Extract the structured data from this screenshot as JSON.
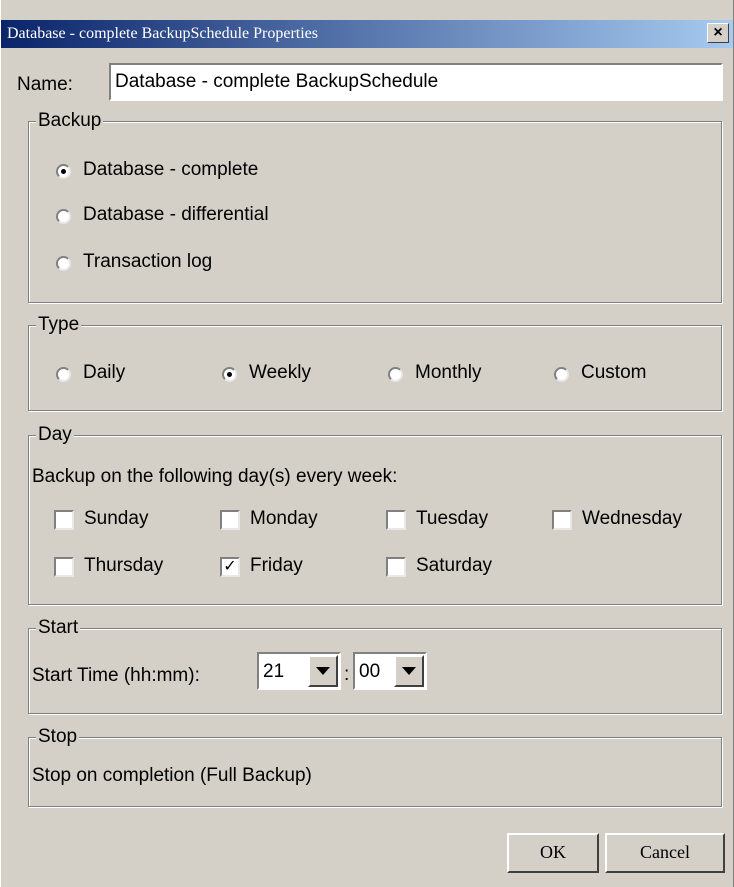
{
  "window": {
    "title": "Database - complete BackupSchedule Properties",
    "close_glyph": "×"
  },
  "name": {
    "label": "Name:",
    "value": "Database - complete BackupSchedule"
  },
  "backup": {
    "legend": "Backup",
    "options": [
      "Database - complete",
      "Database - differential",
      "Transaction log"
    ],
    "selected": "Database - complete"
  },
  "type": {
    "legend": "Type",
    "options": [
      "Daily",
      "Weekly",
      "Monthly",
      "Custom"
    ],
    "selected": "Weekly"
  },
  "day": {
    "legend": "Day",
    "description": "Backup on the following day(s) every week:",
    "days": [
      {
        "label": "Sunday",
        "checked": false
      },
      {
        "label": "Monday",
        "checked": false
      },
      {
        "label": "Tuesday",
        "checked": false
      },
      {
        "label": "Wednesday",
        "checked": false
      },
      {
        "label": "Thursday",
        "checked": false
      },
      {
        "label": "Friday",
        "checked": true
      },
      {
        "label": "Saturday",
        "checked": false
      }
    ],
    "check_glyph": "✓"
  },
  "start": {
    "legend": "Start",
    "label": "Start Time (hh:mm):",
    "hour": "21",
    "separator": ":",
    "minute": "00"
  },
  "stop": {
    "legend": "Stop",
    "text": "Stop on completion (Full Backup)"
  },
  "buttons": {
    "ok": "OK",
    "cancel": "Cancel"
  }
}
